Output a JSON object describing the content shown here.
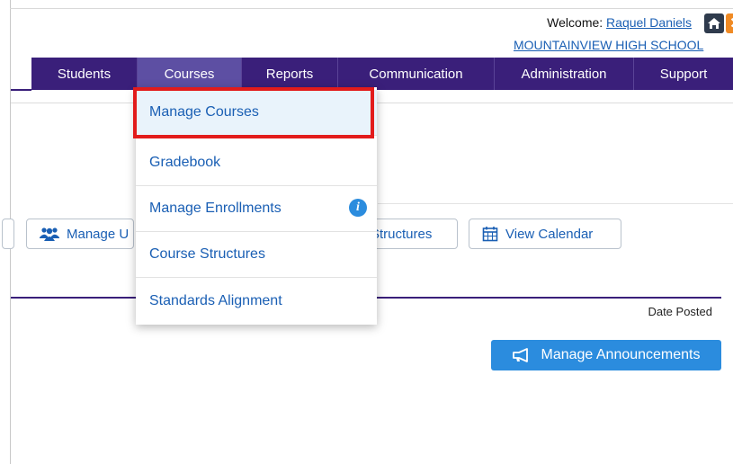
{
  "header": {
    "welcome_label": "Welcome:",
    "user_name": "Raquel Daniels",
    "school_name": "MOUNTAINVIEW HIGH SCHOOL",
    "home_icon": "home-icon",
    "close_icon": "close-icon"
  },
  "nav": {
    "items": [
      {
        "label": "Students"
      },
      {
        "label": "Courses"
      },
      {
        "label": "Reports"
      },
      {
        "label": "Communication"
      },
      {
        "label": "Administration"
      },
      {
        "label": "Support"
      }
    ],
    "active": "Courses",
    "color": "#3a1f7a",
    "active_color": "#5d4fa3"
  },
  "dropdown": {
    "items": [
      {
        "label": "Manage Courses",
        "highlighted": true
      },
      {
        "label": "Gradebook"
      },
      {
        "label": "Manage Enrollments",
        "icon": "info-icon"
      },
      {
        "label": "Course Structures"
      },
      {
        "label": "Standards Alignment"
      }
    ],
    "highlight_color": "#e21b1b"
  },
  "toolbar": {
    "manage_u_label": "Manage U",
    "manage_u_icon": "users-icon",
    "structures_label": "Structures",
    "calendar_label": "View Calendar",
    "calendar_icon": "calendar-icon"
  },
  "table": {
    "date_posted_header": "Date Posted"
  },
  "announcements": {
    "button_label": "Manage Announcements",
    "button_icon": "megaphone-icon",
    "button_color": "#2b8cde"
  }
}
